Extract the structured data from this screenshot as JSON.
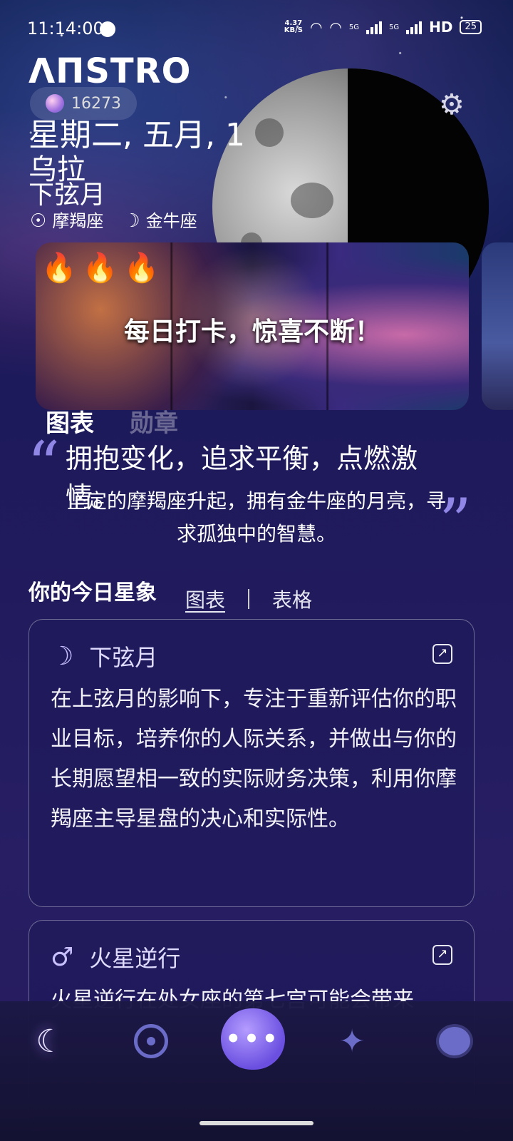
{
  "status_bar": {
    "time": "11:14:00",
    "speed_value": "4.37",
    "speed_unit": "KB/S",
    "signal1_label": "5G",
    "signal2_label": "5G",
    "hd_label": "HD",
    "battery": "25"
  },
  "header": {
    "logo_text": "ΛΠSTRO",
    "points": "16273",
    "date": "星期二, 五月, 1",
    "location": "乌拉",
    "moon_phase": "下弦月",
    "sun_sign": "摩羯座",
    "moon_sign": "金牛座"
  },
  "banner": {
    "flames": "🔥🔥🔥",
    "text": "每日打卡，惊喜不断！"
  },
  "top_tabs": {
    "chart_label": "图表",
    "badges_label": "勋章"
  },
  "quote": {
    "title": "拥抱变化，追求平衡，点燃激情。",
    "body": "坚定的摩羯座升起，拥有金牛座的月亮，寻求孤独中的智慧。"
  },
  "horoscope": {
    "section_title": "你的今日星象",
    "view_chart": "图表",
    "view_table": "表格"
  },
  "cards": [
    {
      "icon": "moon-icon",
      "title": "下弦月",
      "body": "在上弦月的影响下，专注于重新评估你的职业目标，培养你的人际关系，并做出与你的长期愿望相一致的实际财务决策，利用你摩羯座主导星盘的决心和实际性。"
    },
    {
      "icon": "mars-icon",
      "title": "火星逆行",
      "body": "火星逆行在处女座的第七宫可能会带来"
    }
  ],
  "colors": {
    "accent": "#8f86e6",
    "nav_icon": "#6a6cc8",
    "chat_button": "#7b5cf0"
  }
}
